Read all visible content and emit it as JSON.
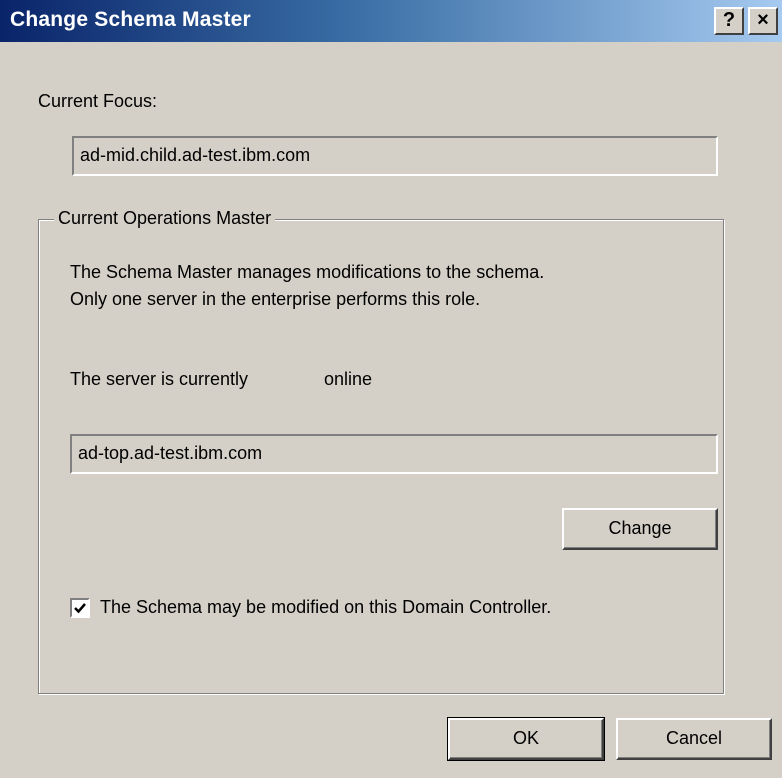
{
  "window": {
    "title": "Change Schema Master",
    "help_label": "?",
    "close_label": "×"
  },
  "current_focus": {
    "label": "Current Focus:",
    "value": "ad-mid.child.ad-test.ibm.com"
  },
  "operations_master": {
    "group_label": "Current Operations Master",
    "description_line1": "The Schema Master manages modifications to the schema.",
    "description_line2": "Only one server in the enterprise performs this role.",
    "status_label": "The server is currently",
    "status_value": "online",
    "server_value": "ad-top.ad-test.ibm.com",
    "change_button": "Change",
    "checkbox_label": "The Schema may be modified on this Domain Controller.",
    "checkbox_checked": true
  },
  "footer": {
    "ok_label": "OK",
    "cancel_label": "Cancel"
  }
}
